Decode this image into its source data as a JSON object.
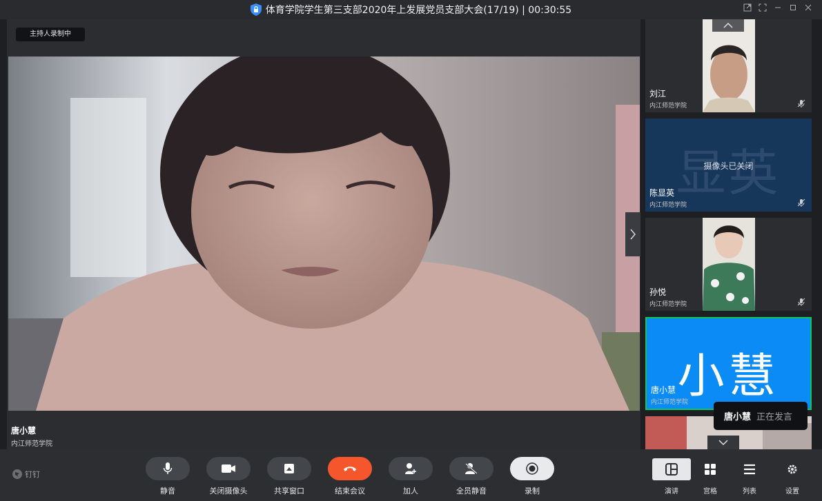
{
  "window": {
    "title": "体育学院学生第三支部2020年上发展党员支部大会(17/19) | 00:30:55",
    "controls": [
      "pop-out-icon",
      "fullscreen-icon",
      "minimize-icon",
      "maximize-icon",
      "close-icon"
    ]
  },
  "stage": {
    "recording_badge": "主持人录制中",
    "speaker_name": "唐小慧",
    "speaker_org": "内江师范学院"
  },
  "participants": [
    {
      "name": "刘江",
      "org": "内江师范学院",
      "muted": true,
      "camera": "on"
    },
    {
      "name": "陈显英",
      "org": "内江师范学院",
      "muted": true,
      "camera": "off",
      "avatar_text": "显英",
      "camera_off_text": "摄像头已关闭"
    },
    {
      "name": "孙悦",
      "org": "内江师范学院",
      "muted": true,
      "camera": "on"
    },
    {
      "name": "唐小慧",
      "org": "内江师范学院",
      "muted": false,
      "camera": "avatar",
      "avatar_text": "小慧",
      "active": true
    }
  ],
  "speaking_toast": {
    "name": "唐小慧",
    "status": "正在发言"
  },
  "toolbar": {
    "brand": "钉钉",
    "buttons": {
      "mute": "静音",
      "camera_off": "关闭摄像头",
      "share": "共享窗口",
      "end": "结束会议",
      "add": "加人",
      "mute_all": "全员静音",
      "record": "录制"
    },
    "views": {
      "speaker": "演讲",
      "gallery": "宫格",
      "list": "列表",
      "settings": "设置"
    }
  },
  "colors": {
    "end_button": "#f6562b",
    "active_tile": "#0b8bf5",
    "active_border": "#18c25a",
    "camera_off_tile": "#16365a"
  }
}
